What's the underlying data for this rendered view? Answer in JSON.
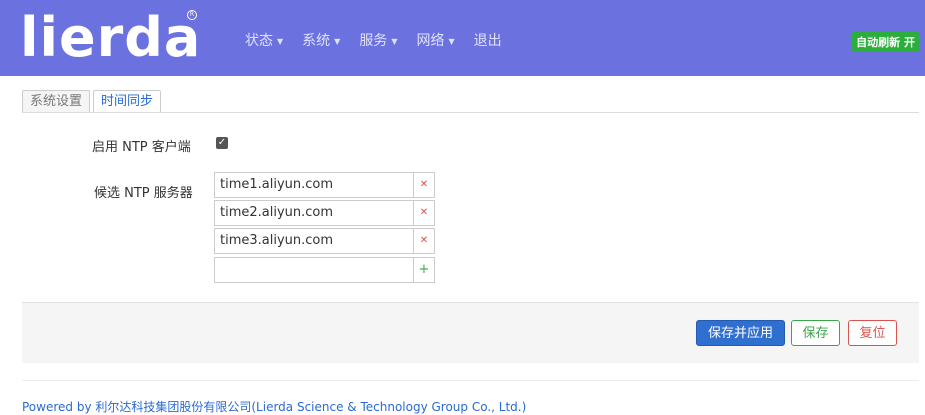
{
  "header": {
    "logo": "lierda",
    "nav": [
      {
        "label": "状态"
      },
      {
        "label": "系统"
      },
      {
        "label": "服务"
      },
      {
        "label": "网络"
      }
    ],
    "logout": "退出",
    "autorefresh": "自动刷新 开",
    "colors": {
      "header_bg": "#6b72e0",
      "autorefresh_bg": "#2bae3c"
    }
  },
  "tabs": [
    {
      "label": "系统设置",
      "active": false
    },
    {
      "label": "时间同步",
      "active": true
    }
  ],
  "form": {
    "ntp_client_label": "启用 NTP 客户端",
    "ntp_client_checked": true,
    "servers_label": "候选 NTP 服务器",
    "servers": [
      "time1.aliyun.com",
      "time2.aliyun.com",
      "time3.aliyun.com"
    ],
    "new_server_value": ""
  },
  "actions": {
    "apply": "保存并应用",
    "save": "保存",
    "reset": "复位"
  },
  "footer": "Powered by 利尔达科技集团股份有限公司(Lierda Science & Technology Group Co., Ltd.)"
}
